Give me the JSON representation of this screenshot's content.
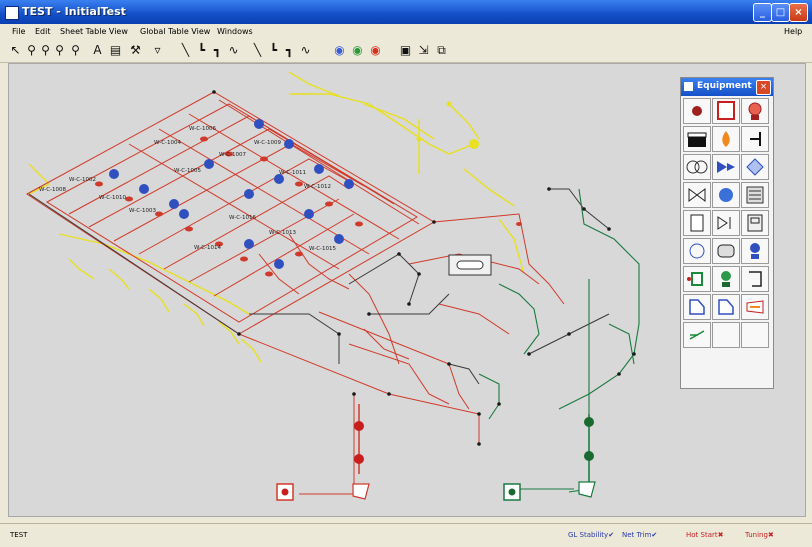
{
  "window": {
    "title": "TEST - InitialTest"
  },
  "menu": {
    "items": [
      "File",
      "Edit",
      "Sheet Table View",
      "Global Table View",
      "Windows"
    ],
    "help": "Help"
  },
  "palette": {
    "title": "Equipment"
  },
  "drawing": {
    "labels": [
      "W-C-1002",
      "W-C-1004",
      "W-C-1006",
      "W-C-1008",
      "W-C-1010",
      "W-C-1003",
      "W-C-1005",
      "W-C-1007",
      "W-C-1009",
      "W-C-1011",
      "W-C-1012",
      "W-C-1014",
      "W-C-1016",
      "W-C-1013",
      "W-C-1015"
    ]
  },
  "status": {
    "left": "TEST",
    "checks": [
      {
        "label": "GL Stability",
        "mark": "✔",
        "color": "#2a3aa8"
      },
      {
        "label": "Net Trim",
        "mark": "✔",
        "color": "#2a3aa8"
      },
      {
        "label": "Hot Start",
        "mark": "✖",
        "color": "#c82020"
      },
      {
        "label": "Tuning",
        "mark": "✖",
        "color": "#c82020"
      }
    ]
  },
  "colors": {
    "red_line": "#d03a2a",
    "yellow_line": "#e8e020",
    "green_line": "#1a7a40",
    "equip_blue": "#3050c0"
  }
}
